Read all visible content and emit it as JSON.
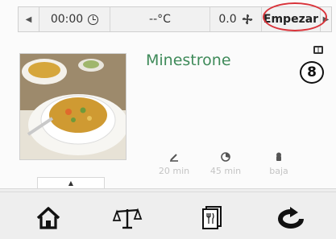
{
  "topbar": {
    "timer_value": "00:00",
    "temperature_value": "--°C",
    "speed_value": "0.0",
    "start_label": "Empezar"
  },
  "recipe": {
    "title": "Minestrone",
    "step_number": "8"
  },
  "stats": [
    {
      "icon": "prep-time-icon",
      "value": "20 min"
    },
    {
      "icon": "total-time-icon",
      "value": "45 min"
    },
    {
      "icon": "difficulty-icon",
      "value": "baja"
    }
  ],
  "bottom_nav": [
    {
      "icon": "home-icon"
    },
    {
      "icon": "scale-icon"
    },
    {
      "icon": "recipes-icon"
    },
    {
      "icon": "reverse-icon"
    }
  ],
  "colors": {
    "title_green": "#3e8a59",
    "highlight_red": "#d9333a",
    "stat_gray": "#c4c4c4"
  }
}
